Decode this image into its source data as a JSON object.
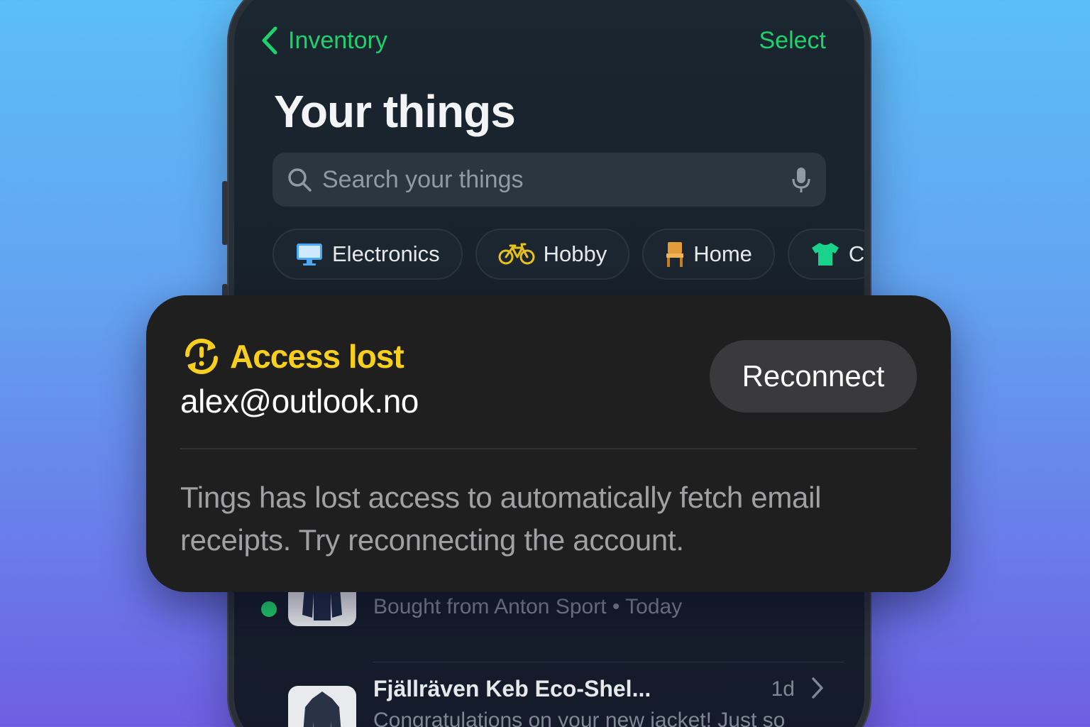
{
  "nav": {
    "back_label": "Inventory",
    "select_label": "Select"
  },
  "page_title": "Your things",
  "search": {
    "placeholder": "Search your things"
  },
  "categories": [
    {
      "label": "Electronics",
      "icon": "monitor-icon"
    },
    {
      "label": "Hobby",
      "icon": "bicycle-icon"
    },
    {
      "label": "Home",
      "icon": "chair-icon"
    },
    {
      "label": "C",
      "icon": "tshirt-icon"
    }
  ],
  "items": [
    {
      "subtitle": "Bought from Anton Sport • Today",
      "unread": true
    },
    {
      "title": "Fjällräven Keb Eco-Shel...",
      "time": "1d",
      "subtitle": "Congratulations on your new jacket! Just so"
    }
  ],
  "alert": {
    "title": "Access lost",
    "account": "alex@outlook.no",
    "action_label": "Reconnect",
    "message": "Tings has lost access to automatically fetch email receipts. Try reconnecting the account."
  },
  "colors": {
    "accent": "#1fd16b",
    "warning": "#f8cf1c",
    "card_bg": "#1f1f1f",
    "screen_bg": "#18212b"
  }
}
